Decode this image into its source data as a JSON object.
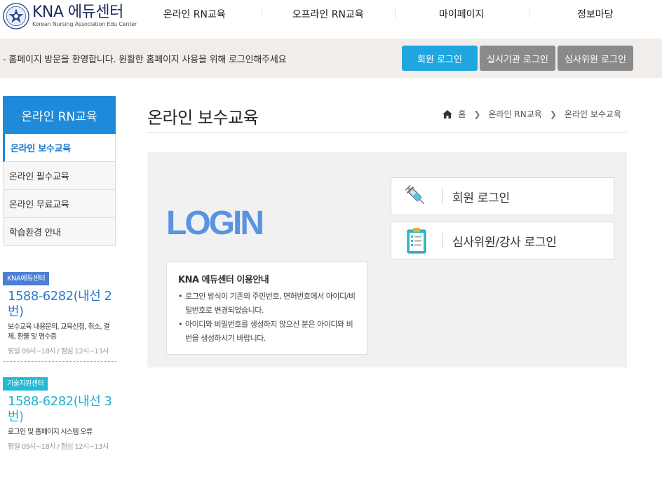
{
  "header": {
    "logo_main": "KNA 에듀센터",
    "logo_sub": "Korean Nursing Association Edu Center",
    "nav": [
      "온라인 RN교육",
      "오프라인 RN교육",
      "마이페이지",
      "정보마당"
    ]
  },
  "notice": {
    "text": "- 홈페이지 방문을 환영합니다. 원활한 홈페이지 사용을 위해 로그인해주세요",
    "member_login": "회원 로그인",
    "institution_login": "실시기관 로그인",
    "reviewer_login": "심사위원 로그인"
  },
  "sidebar": {
    "title": "온라인 RN교육",
    "items": [
      {
        "label": "온라인 보수교육"
      },
      {
        "label": "온라인 필수교육"
      },
      {
        "label": "온라인 무료교육"
      },
      {
        "label": "학습환경 안내"
      }
    ],
    "contacts": [
      {
        "tag": "KNA에듀센터",
        "phone": "1588-6282(내선 2번)",
        "desc": "보수교육 내용문의, 교육신청, 취소, 결제, 환불 및 영수증",
        "hours": "평일 09시~18시 / 점심 12시~13시"
      },
      {
        "tag": "기술지원센터",
        "phone": "1588-6282(내선 3번)",
        "desc": "로그인 및 홈페이지 시스템 오류",
        "hours": "평일 09시~18시 / 점심 12시~13시"
      }
    ]
  },
  "main": {
    "title": "온라인 보수교육",
    "breadcrumb": [
      "홈",
      "온라인 RN교육",
      "온라인 보수교육"
    ],
    "login_word": "LOGIN",
    "info": {
      "title": "KNA 에듀센터 이용안내",
      "items": [
        "로그인 방식이 기존의 주민번호, 면허번호에서 아이디/비밀번호로 변경되었습니다.",
        "아이디와 비밀번호를 생성하지 않으신 분은 아이디와 비번을 생성하시기 바랍니다."
      ]
    },
    "buttons": [
      {
        "label": "회원 로그인",
        "icon": "syringe-icon"
      },
      {
        "label": "심사위원/강사 로그인",
        "icon": "clipboard-icon"
      }
    ]
  },
  "colors": {
    "accent_blue": "#1e8ad9",
    "member_button": "#1fa6e0",
    "gray_button": "#8a8a8a",
    "login_word": "#5a93e0"
  }
}
